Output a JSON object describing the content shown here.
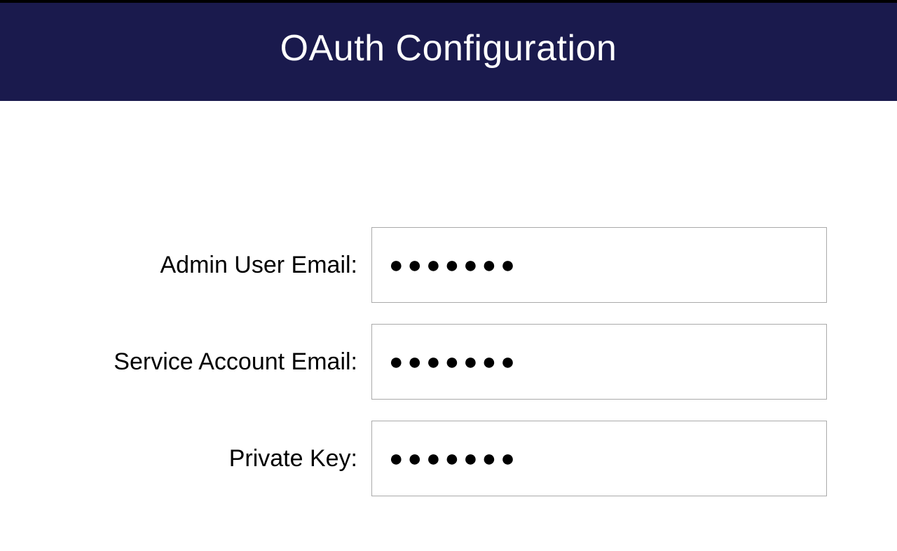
{
  "header": {
    "title": "OAuth Configuration"
  },
  "form": {
    "fields": [
      {
        "label": "Admin User Email:",
        "value": "●●●●●●●"
      },
      {
        "label": "Service Account Email:",
        "value": "●●●●●●●"
      },
      {
        "label": "Private Key:",
        "value": "●●●●●●●"
      }
    ]
  }
}
